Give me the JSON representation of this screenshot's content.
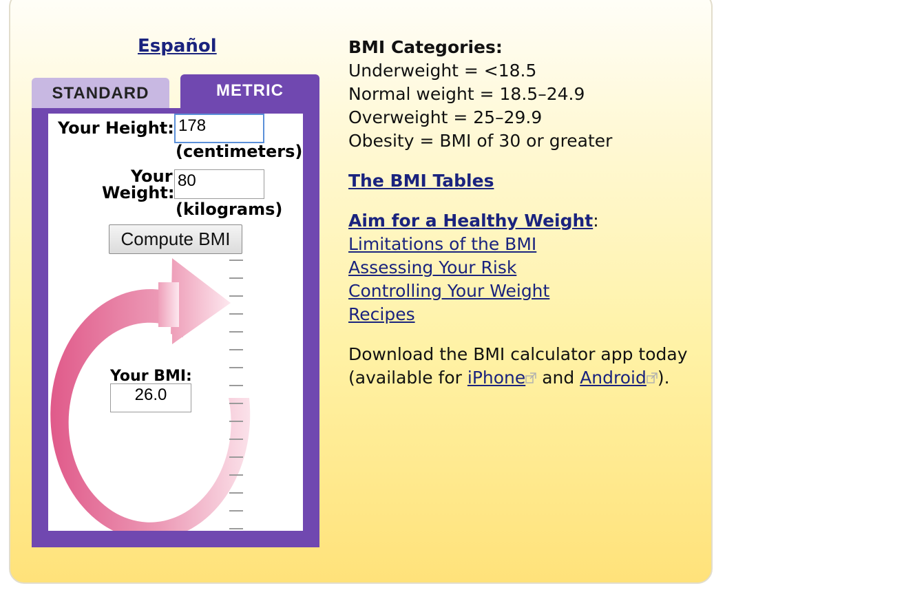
{
  "language_link": "Español",
  "tabs": {
    "standard": "STANDARD",
    "metric": "METRIC"
  },
  "calculator": {
    "height_label": "Your Height:",
    "height_value": "178",
    "height_unit": "(centimeters)",
    "weight_label_1": "Your",
    "weight_label_2": "Weight:",
    "weight_value": "80",
    "weight_unit": "(kilograms)",
    "compute_button": "Compute BMI",
    "result_label": "Your BMI:",
    "result_value": "26.0"
  },
  "categories": {
    "title": "BMI Categories:",
    "items": [
      "Underweight = <18.5",
      "Normal weight = 18.5–24.9",
      "Overweight = 25–29.9",
      "Obesity = BMI of 30 or greater"
    ]
  },
  "links": {
    "bmi_tables": "The BMI Tables",
    "aim_healthy": "Aim for a Healthy Weight",
    "aim_colon": ":",
    "sub_links": [
      "Limitations of the BMI",
      "Assessing Your Risk",
      "Controlling Your Weight",
      "Recipes"
    ]
  },
  "download": {
    "line1": "Download the BMI calculator app today",
    "line2_prefix": "(available for ",
    "iphone": "iPhone",
    "middle": " and ",
    "android": "Android",
    "suffix": ")."
  },
  "colors": {
    "tab_active": "#7048b0",
    "tab_inactive": "#c8b8e2",
    "link": "#1a237e",
    "arrow_pink": "#e05a8a"
  },
  "icons": [
    "external-link-icon",
    "circular-arrow-graphic",
    "ruler-scale"
  ]
}
